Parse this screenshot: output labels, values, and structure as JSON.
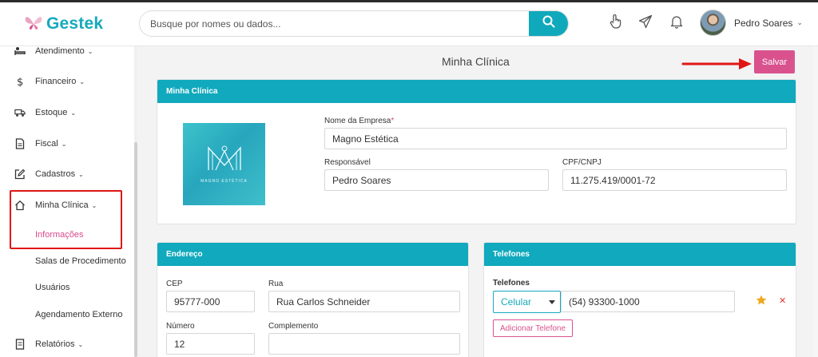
{
  "header": {
    "logo_text": "Gestek",
    "search": {
      "placeholder": "Busque por nomes ou dados..."
    },
    "user_name": "Pedro Soares",
    "user_caret": "⌄"
  },
  "sidebar": {
    "items": [
      {
        "label": "Atendimento",
        "icon": "bed-icon"
      },
      {
        "label": "Financeiro",
        "icon": "dollar-icon"
      },
      {
        "label": "Estoque",
        "icon": "truck-icon"
      },
      {
        "label": "Fiscal",
        "icon": "document-icon"
      },
      {
        "label": "Cadastros",
        "icon": "edit-icon"
      },
      {
        "label": "Minha Clínica",
        "icon": "home-icon"
      },
      {
        "label": "Relatórios",
        "icon": "report-icon"
      }
    ],
    "sub_items": [
      "Informações",
      "Salas de Procedimento",
      "Usuários",
      "Agendamento Externo"
    ],
    "caret": "⌄"
  },
  "page": {
    "title": "Minha Clínica",
    "save_label": "Salvar"
  },
  "clinic_card": {
    "header": "Minha Clínica",
    "logo_brand": "MAGNO ESTÉTICA",
    "company_label": "Nome da Empresa",
    "required_mark": "*",
    "company_value": "Magno Estética",
    "responsible_label": "Responsável",
    "responsible_value": "Pedro Soares",
    "cnpj_label": "CPF/CNPJ",
    "cnpj_value": "11.275.419/0001-72"
  },
  "address_card": {
    "header": "Endereço",
    "cep_label": "CEP",
    "cep_value": "95777-000",
    "street_label": "Rua",
    "street_value": "Rua Carlos Schneider",
    "number_label": "Número",
    "number_value": "12",
    "complement_label": "Complemento",
    "complement_value": ""
  },
  "phones_card": {
    "header": "Telefones",
    "label": "Telefones",
    "type_value": "Celular",
    "phone_value": "(54) 93300-1000",
    "add_label": "Adicionar Telefone",
    "remove_symbol": "✕"
  },
  "colors": {
    "accent": "#11a9bd",
    "pink": "#d9528e",
    "highlight_red": "#e01616"
  }
}
